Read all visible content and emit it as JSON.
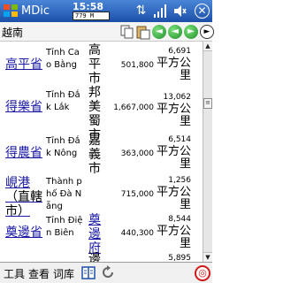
{
  "titlebar": {
    "title": "MDic",
    "time": "15:58",
    "memory": "779 M",
    "close_label": "ok"
  },
  "toolbar": {
    "search_value": "越南",
    "back_label": "◄",
    "prev_label": "◄",
    "next_label": "►",
    "forward_label": "►"
  },
  "rows": [
    {
      "name": "高平省",
      "viet": "Tỉnh Cao Bằng",
      "capital": "高平市",
      "population": "501,800",
      "area": "6,691",
      "unit": "平方公里",
      "capital_link": false
    },
    {
      "name": "得樂省",
      "viet": "Tỉnh Đắk Lắk",
      "capital": "邦美蜀市",
      "population": "1,667,000",
      "area": "13,062",
      "unit": "平方公里",
      "capital_link": false
    },
    {
      "name": "得農省",
      "viet": "Tỉnh Đắk Nông",
      "capital": "嘉義市",
      "population": "363,000",
      "area": "6,514",
      "unit": "平方公里",
      "capital_link": false
    },
    {
      "name": "峴港",
      "name_suffix": "（直轄市）",
      "viet": "Thành phố Đà Nẵng",
      "capital": "",
      "population": "715,000",
      "area": "1,256",
      "unit": "平方公里",
      "capital_link": false
    },
    {
      "name": "奠邊省",
      "viet": "Tỉnh Điện Biên",
      "capital": "奠邊府",
      "population": "440,300",
      "area": "8,544",
      "unit": "平方公里",
      "capital_link": true
    },
    {
      "name": "",
      "viet": "",
      "capital": "邊",
      "population": "",
      "area": "5,895",
      "unit": "",
      "capital_link": false
    }
  ],
  "menubar": {
    "tools": "工具",
    "view": "查看",
    "dictionary": "词库"
  },
  "colors": {
    "title_bar": "#1c4fa8",
    "link": "#1a1aa6",
    "nav_button": "#1f8f2a",
    "input_method": "#d01818"
  }
}
